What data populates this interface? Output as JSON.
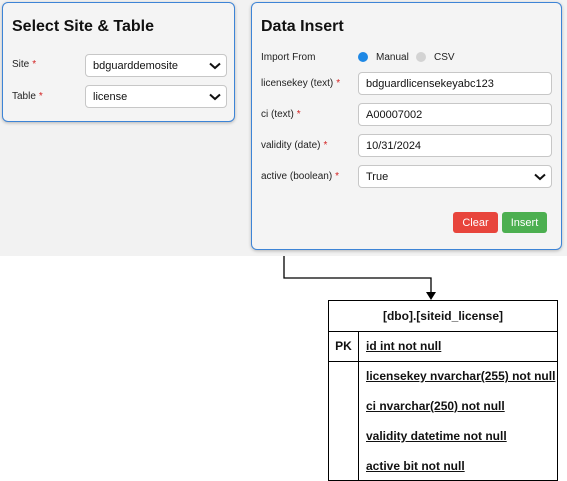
{
  "select_panel": {
    "title": "Select Site & Table",
    "site_label": "Site",
    "site_value": "bdguarddemosite",
    "table_label": "Table",
    "table_value": "license",
    "required_mark": "*"
  },
  "insert_panel": {
    "title": "Data Insert",
    "import_from_label": "Import From",
    "import_options": [
      "Manual",
      "CSV"
    ],
    "import_selected": "Manual",
    "fields": [
      {
        "label": "licensekey (text)",
        "value": "bdguardlicensekeyabc123"
      },
      {
        "label": "ci (text)",
        "value": "A00007002"
      },
      {
        "label": "validity (date)",
        "value": "10/31/2024"
      },
      {
        "label": "active (boolean)",
        "value": "True"
      }
    ],
    "clear_label": "Clear",
    "insert_label": "Insert"
  },
  "erd": {
    "table_name": "[dbo].[siteid_license]",
    "pk_label": "PK",
    "pk_field": "id int not null",
    "fields": [
      "licensekey nvarchar(255) not null",
      "ci nvarchar(250) not null",
      "validity datetime not null",
      "active bit not null"
    ]
  },
  "colors": {
    "accent": "#3d84d6",
    "clear_button": "#e8453c",
    "insert_button": "#4caf50",
    "required": "#d21f1f"
  }
}
